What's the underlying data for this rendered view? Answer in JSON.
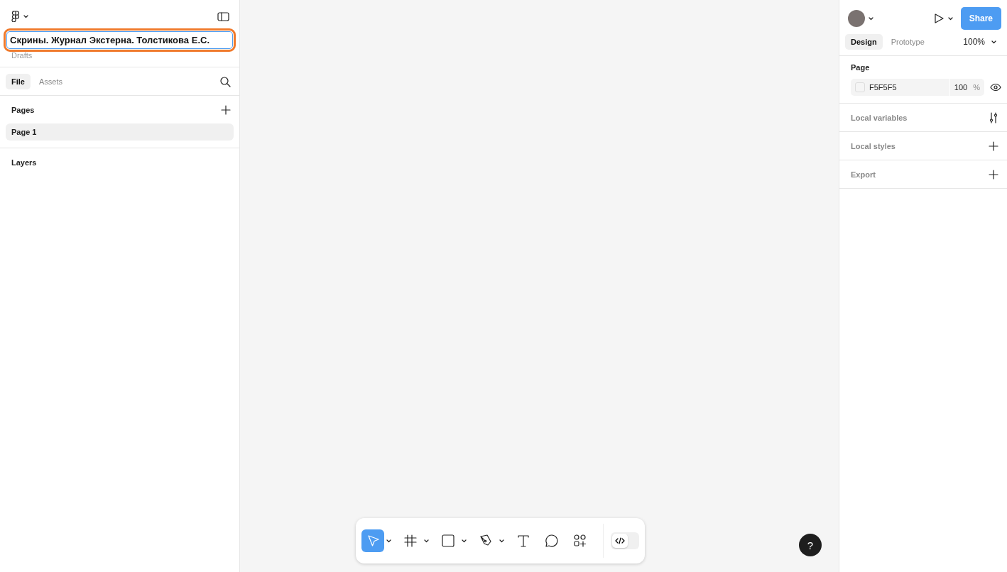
{
  "file": {
    "name": "Скрины. Журнал Экстерна. Толстикова Е.С.",
    "location": "Drafts"
  },
  "left_tabs": [
    {
      "label": "File",
      "selected": true
    },
    {
      "label": "Assets",
      "selected": false
    }
  ],
  "pages": {
    "title": "Pages",
    "items": [
      {
        "label": "Page 1",
        "selected": true
      }
    ]
  },
  "layers": {
    "title": "Layers"
  },
  "header": {
    "share": "Share"
  },
  "right_tabs": [
    {
      "label": "Design",
      "selected": true
    },
    {
      "label": "Prototype",
      "selected": false
    }
  ],
  "zoom": "100%",
  "page_section": {
    "title": "Page",
    "color": "F5F5F5",
    "opacity": "100",
    "unit": "%"
  },
  "sections": [
    {
      "title": "Local variables",
      "kind": "variables"
    },
    {
      "title": "Local styles",
      "kind": "add"
    },
    {
      "title": "Export",
      "kind": "add"
    }
  ],
  "tools": [
    {
      "kind": "move",
      "selected": true,
      "menu": true
    },
    {
      "kind": "frame",
      "selected": false,
      "menu": true
    },
    {
      "kind": "shape",
      "selected": false,
      "menu": true
    },
    {
      "kind": "pen",
      "selected": false,
      "menu": true
    },
    {
      "kind": "text",
      "selected": false,
      "menu": false
    },
    {
      "kind": "comment",
      "selected": false,
      "menu": false
    },
    {
      "kind": "actions",
      "selected": false,
      "menu": false
    }
  ],
  "dev_mode": {
    "on": false
  },
  "help": "?"
}
